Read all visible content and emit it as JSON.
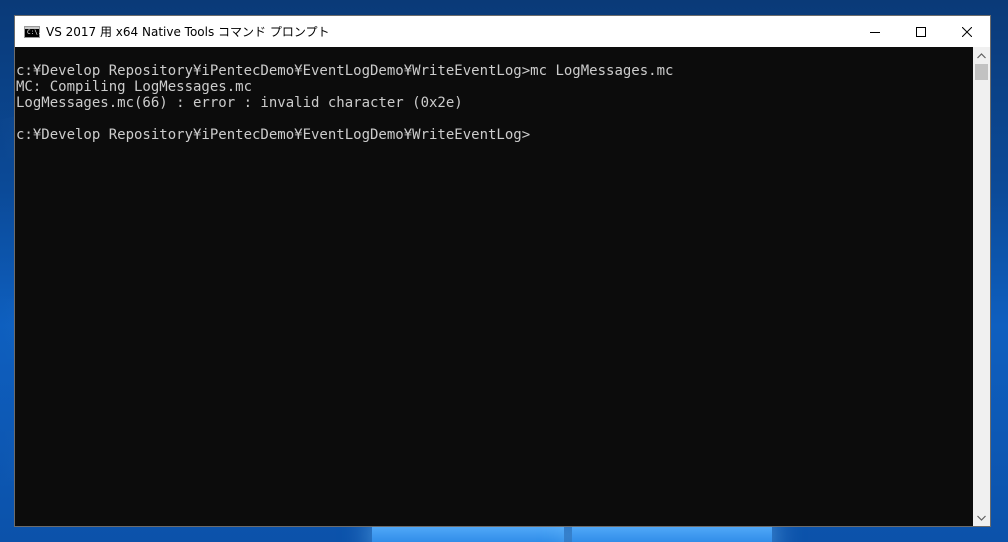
{
  "window": {
    "title": "VS 2017 用 x64 Native Tools コマンド プロンプト",
    "icon_text": "C:\\.",
    "controls": [
      "minimize-icon",
      "maximize-icon",
      "close-icon"
    ]
  },
  "console": {
    "lines": [
      "c:¥Develop Repository¥iPentecDemo¥EventLogDemo¥WriteEventLog>mc LogMessages.mc",
      "MC: Compiling LogMessages.mc",
      "LogMessages.mc(66) : error : invalid character (0x2e)",
      "",
      "c:¥Develop Repository¥iPentecDemo¥EventLogDemo¥WriteEventLog>"
    ]
  },
  "scrollbar": {
    "position": 0
  },
  "colors": {
    "console_background": "#0c0c0c",
    "console_text": "#cccccc",
    "titlebar": "#ffffff",
    "desktop": "#0b4a98"
  }
}
